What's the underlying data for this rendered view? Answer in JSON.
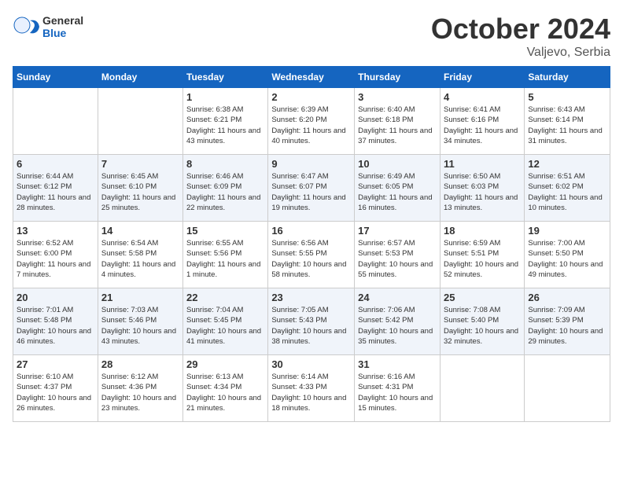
{
  "logo": {
    "general": "General",
    "blue": "Blue"
  },
  "title": "October 2024",
  "location": "Valjevo, Serbia",
  "weekdays": [
    "Sunday",
    "Monday",
    "Tuesday",
    "Wednesday",
    "Thursday",
    "Friday",
    "Saturday"
  ],
  "weeks": [
    [
      {
        "day": "",
        "sunrise": "",
        "sunset": "",
        "daylight": ""
      },
      {
        "day": "",
        "sunrise": "",
        "sunset": "",
        "daylight": ""
      },
      {
        "day": "1",
        "sunrise": "Sunrise: 6:38 AM",
        "sunset": "Sunset: 6:21 PM",
        "daylight": "Daylight: 11 hours and 43 minutes."
      },
      {
        "day": "2",
        "sunrise": "Sunrise: 6:39 AM",
        "sunset": "Sunset: 6:20 PM",
        "daylight": "Daylight: 11 hours and 40 minutes."
      },
      {
        "day": "3",
        "sunrise": "Sunrise: 6:40 AM",
        "sunset": "Sunset: 6:18 PM",
        "daylight": "Daylight: 11 hours and 37 minutes."
      },
      {
        "day": "4",
        "sunrise": "Sunrise: 6:41 AM",
        "sunset": "Sunset: 6:16 PM",
        "daylight": "Daylight: 11 hours and 34 minutes."
      },
      {
        "day": "5",
        "sunrise": "Sunrise: 6:43 AM",
        "sunset": "Sunset: 6:14 PM",
        "daylight": "Daylight: 11 hours and 31 minutes."
      }
    ],
    [
      {
        "day": "6",
        "sunrise": "Sunrise: 6:44 AM",
        "sunset": "Sunset: 6:12 PM",
        "daylight": "Daylight: 11 hours and 28 minutes."
      },
      {
        "day": "7",
        "sunrise": "Sunrise: 6:45 AM",
        "sunset": "Sunset: 6:10 PM",
        "daylight": "Daylight: 11 hours and 25 minutes."
      },
      {
        "day": "8",
        "sunrise": "Sunrise: 6:46 AM",
        "sunset": "Sunset: 6:09 PM",
        "daylight": "Daylight: 11 hours and 22 minutes."
      },
      {
        "day": "9",
        "sunrise": "Sunrise: 6:47 AM",
        "sunset": "Sunset: 6:07 PM",
        "daylight": "Daylight: 11 hours and 19 minutes."
      },
      {
        "day": "10",
        "sunrise": "Sunrise: 6:49 AM",
        "sunset": "Sunset: 6:05 PM",
        "daylight": "Daylight: 11 hours and 16 minutes."
      },
      {
        "day": "11",
        "sunrise": "Sunrise: 6:50 AM",
        "sunset": "Sunset: 6:03 PM",
        "daylight": "Daylight: 11 hours and 13 minutes."
      },
      {
        "day": "12",
        "sunrise": "Sunrise: 6:51 AM",
        "sunset": "Sunset: 6:02 PM",
        "daylight": "Daylight: 11 hours and 10 minutes."
      }
    ],
    [
      {
        "day": "13",
        "sunrise": "Sunrise: 6:52 AM",
        "sunset": "Sunset: 6:00 PM",
        "daylight": "Daylight: 11 hours and 7 minutes."
      },
      {
        "day": "14",
        "sunrise": "Sunrise: 6:54 AM",
        "sunset": "Sunset: 5:58 PM",
        "daylight": "Daylight: 11 hours and 4 minutes."
      },
      {
        "day": "15",
        "sunrise": "Sunrise: 6:55 AM",
        "sunset": "Sunset: 5:56 PM",
        "daylight": "Daylight: 11 hours and 1 minute."
      },
      {
        "day": "16",
        "sunrise": "Sunrise: 6:56 AM",
        "sunset": "Sunset: 5:55 PM",
        "daylight": "Daylight: 10 hours and 58 minutes."
      },
      {
        "day": "17",
        "sunrise": "Sunrise: 6:57 AM",
        "sunset": "Sunset: 5:53 PM",
        "daylight": "Daylight: 10 hours and 55 minutes."
      },
      {
        "day": "18",
        "sunrise": "Sunrise: 6:59 AM",
        "sunset": "Sunset: 5:51 PM",
        "daylight": "Daylight: 10 hours and 52 minutes."
      },
      {
        "day": "19",
        "sunrise": "Sunrise: 7:00 AM",
        "sunset": "Sunset: 5:50 PM",
        "daylight": "Daylight: 10 hours and 49 minutes."
      }
    ],
    [
      {
        "day": "20",
        "sunrise": "Sunrise: 7:01 AM",
        "sunset": "Sunset: 5:48 PM",
        "daylight": "Daylight: 10 hours and 46 minutes."
      },
      {
        "day": "21",
        "sunrise": "Sunrise: 7:03 AM",
        "sunset": "Sunset: 5:46 PM",
        "daylight": "Daylight: 10 hours and 43 minutes."
      },
      {
        "day": "22",
        "sunrise": "Sunrise: 7:04 AM",
        "sunset": "Sunset: 5:45 PM",
        "daylight": "Daylight: 10 hours and 41 minutes."
      },
      {
        "day": "23",
        "sunrise": "Sunrise: 7:05 AM",
        "sunset": "Sunset: 5:43 PM",
        "daylight": "Daylight: 10 hours and 38 minutes."
      },
      {
        "day": "24",
        "sunrise": "Sunrise: 7:06 AM",
        "sunset": "Sunset: 5:42 PM",
        "daylight": "Daylight: 10 hours and 35 minutes."
      },
      {
        "day": "25",
        "sunrise": "Sunrise: 7:08 AM",
        "sunset": "Sunset: 5:40 PM",
        "daylight": "Daylight: 10 hours and 32 minutes."
      },
      {
        "day": "26",
        "sunrise": "Sunrise: 7:09 AM",
        "sunset": "Sunset: 5:39 PM",
        "daylight": "Daylight: 10 hours and 29 minutes."
      }
    ],
    [
      {
        "day": "27",
        "sunrise": "Sunrise: 6:10 AM",
        "sunset": "Sunset: 4:37 PM",
        "daylight": "Daylight: 10 hours and 26 minutes."
      },
      {
        "day": "28",
        "sunrise": "Sunrise: 6:12 AM",
        "sunset": "Sunset: 4:36 PM",
        "daylight": "Daylight: 10 hours and 23 minutes."
      },
      {
        "day": "29",
        "sunrise": "Sunrise: 6:13 AM",
        "sunset": "Sunset: 4:34 PM",
        "daylight": "Daylight: 10 hours and 21 minutes."
      },
      {
        "day": "30",
        "sunrise": "Sunrise: 6:14 AM",
        "sunset": "Sunset: 4:33 PM",
        "daylight": "Daylight: 10 hours and 18 minutes."
      },
      {
        "day": "31",
        "sunrise": "Sunrise: 6:16 AM",
        "sunset": "Sunset: 4:31 PM",
        "daylight": "Daylight: 10 hours and 15 minutes."
      },
      {
        "day": "",
        "sunrise": "",
        "sunset": "",
        "daylight": ""
      },
      {
        "day": "",
        "sunrise": "",
        "sunset": "",
        "daylight": ""
      }
    ]
  ]
}
